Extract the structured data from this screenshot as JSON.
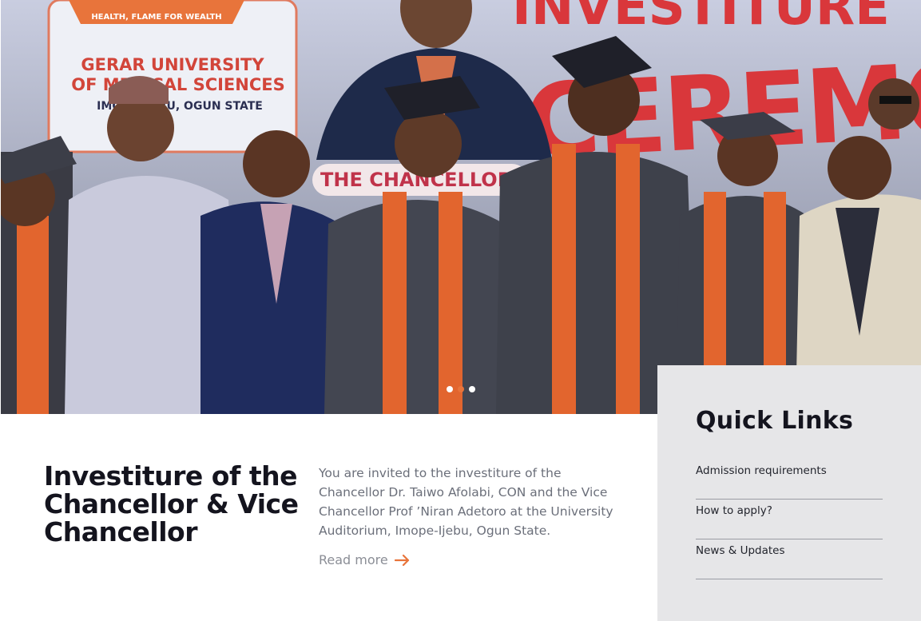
{
  "hero": {
    "image_alt": "Investiture ceremony group photo",
    "banner": {
      "motto": "HEALTH, FLAME FOR WEALTH",
      "university_line1": "GERAR UNIVERSITY",
      "university_line2": "OF MEDICAL SCIENCES",
      "location": "IMOPE-IJEBU, OGUN STATE",
      "heading_top": "INVESTITURE",
      "heading_main": "CEREMONY",
      "subtitle": "THE CHANCELLOR"
    },
    "slides": {
      "count": 3,
      "active_index": 1
    }
  },
  "article": {
    "title": "Investiture of the Chancellor & Vice Chancellor",
    "body": "You are invited to the investiture of the Chancellor Dr. Taiwo Afolabi, CON and the Vice Chancellor Prof ’Niran Adetoro at the University Auditorium, Imope-Ijebu, Ogun State.",
    "read_more_label": "Read more"
  },
  "quick_links": {
    "title": "Quick Links",
    "items": [
      {
        "label": "Admission requirements"
      },
      {
        "label": "How to apply?"
      },
      {
        "label": "News & Updates"
      }
    ]
  },
  "colors": {
    "accent": "#e8743b",
    "title_text": "#14141e",
    "body_text": "#6b6f7a",
    "panel_bg": "#e6e6e8"
  }
}
